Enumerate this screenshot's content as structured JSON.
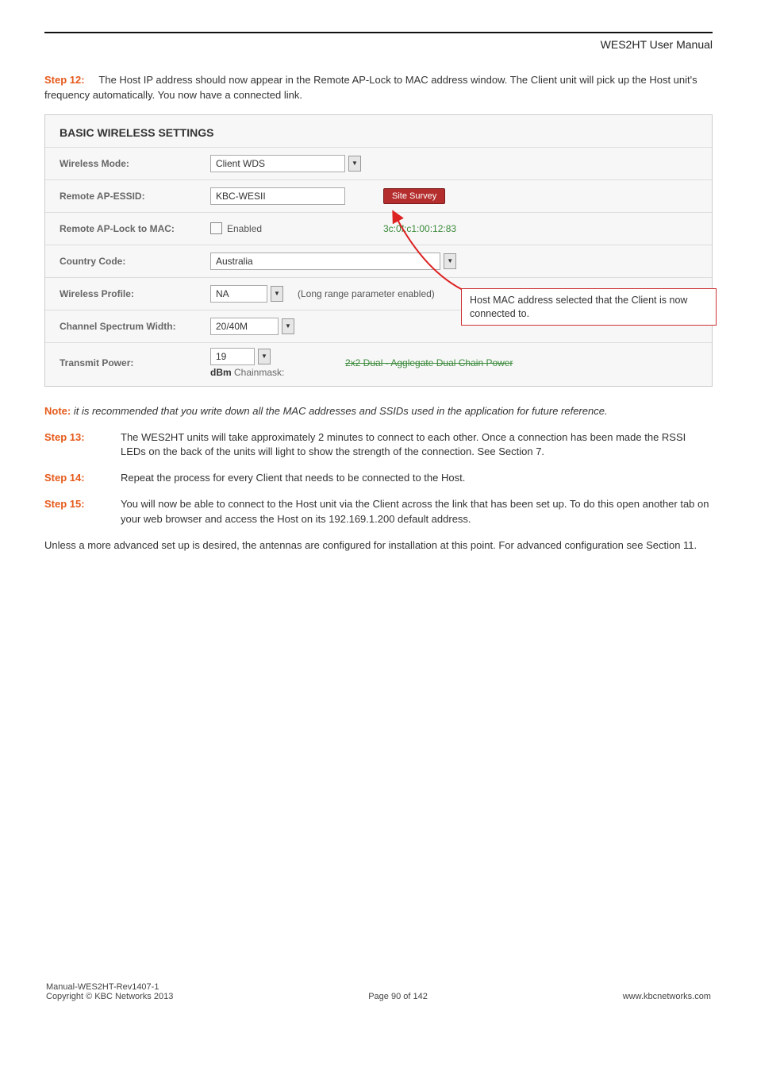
{
  "header": {
    "title": "WES2HT User Manual"
  },
  "intro": {
    "step_label": "Step 12:",
    "text_after": "The Host IP address should now appear in the Remote AP-Lock to MAC address window. The Client unit will pick up the Host unit's frequency automatically. You now have a connected link."
  },
  "panel": {
    "heading": "BASIC WIRELESS SETTINGS",
    "rows": {
      "wireless_mode": {
        "label": "Wireless Mode:",
        "value": "Client WDS"
      },
      "remote_essid": {
        "label": "Remote AP-ESSID:",
        "value": "KBC-WESII",
        "button": "Site Survey"
      },
      "lock_mac": {
        "label": "Remote AP-Lock to MAC:",
        "check_label": "Enabled",
        "mac": "3c:0f:c1:00:12:83"
      },
      "country": {
        "label": "Country Code:",
        "value": "Australia"
      },
      "profile": {
        "label": "Wireless Profile:",
        "value": "NA",
        "paren": "(Long range parameter enabled)"
      },
      "spectrum": {
        "label": "Channel Spectrum Width:",
        "value": "20/40M"
      },
      "tx": {
        "label": "Transmit Power:",
        "value": "19",
        "chainmask": "dBm Chainmask:",
        "agg": "2x2 Dual - Agglegate Dual Chain Power"
      }
    },
    "callout": "Host MAC address selected that the Client is now connected to."
  },
  "note": {
    "label": "Note:",
    "text": " it is recommended that you write down all the MAC addresses and SSIDs used in the application for future reference."
  },
  "steps": [
    {
      "label": "Step 13:",
      "text": "The WES2HT units will take approximately 2 minutes to connect to each other. Once a connection has been made the RSSI LEDs on the back of the units will light to show the strength of the connection. See Section 7."
    },
    {
      "label": "Step 14:",
      "text": "Repeat the process for every Client that needs to be connected to the Host."
    },
    {
      "label": "Step 15:",
      "text": "You will now be able to connect to the Host unit via the Client across the link that has been set up. To do this open another tab on your web browser and access the Host on its 192.169.1.200 default address."
    }
  ],
  "closing": "Unless a more advanced set up is desired, the antennas are configured for installation at this point. For advanced configuration see Section 11.",
  "footer": {
    "left1": "Manual-WES2HT-Rev1407-1",
    "left2": "Copyright © KBC Networks 2013",
    "center": "Page 90 of 142",
    "right": "www.kbcnetworks.com"
  }
}
